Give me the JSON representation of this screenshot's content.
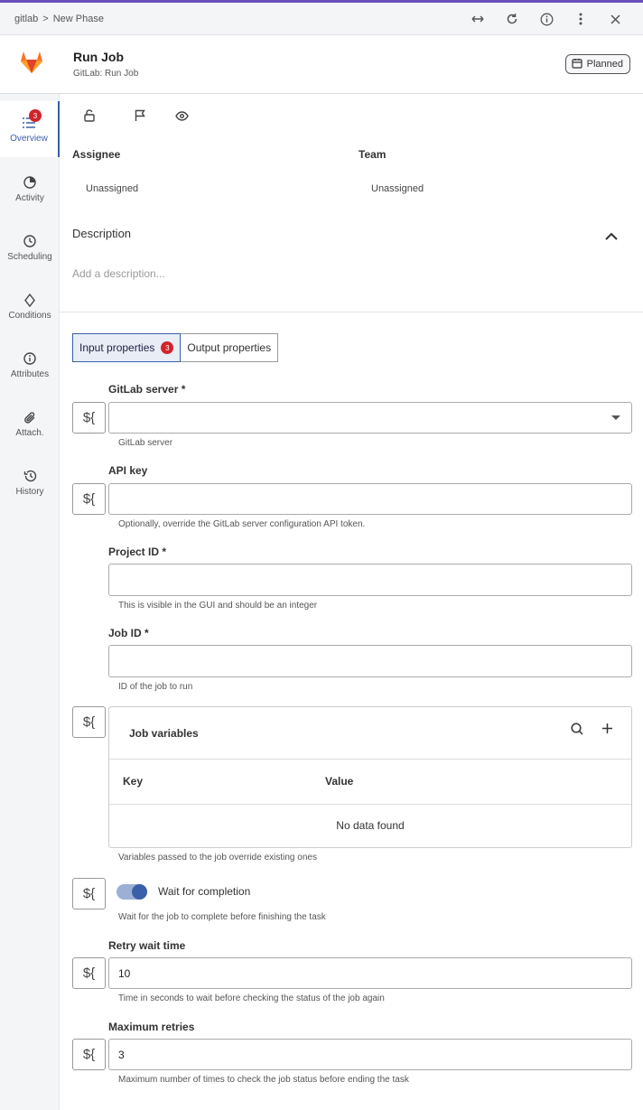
{
  "breadcrumb": {
    "root": "gitlab",
    "sep": ">",
    "current": "New Phase"
  },
  "window_icons": [
    "expand-horizontal-icon",
    "refresh-icon",
    "info-icon",
    "more-vertical-icon",
    "close-icon"
  ],
  "header": {
    "title": "Run Job",
    "subtitle": "GitLab: Run Job",
    "status": "Planned"
  },
  "sidebar": {
    "items": [
      {
        "label": "Overview",
        "icon": "list-icon",
        "badge": "3",
        "active": true
      },
      {
        "label": "Activity",
        "icon": "activity-icon"
      },
      {
        "label": "Scheduling",
        "icon": "clock-icon"
      },
      {
        "label": "Conditions",
        "icon": "diamond-icon"
      },
      {
        "label": "Attributes",
        "icon": "info-icon"
      },
      {
        "label": "Attach.",
        "icon": "paperclip-icon"
      },
      {
        "label": "History",
        "icon": "history-icon"
      }
    ]
  },
  "overview": {
    "assignee_label": "Assignee",
    "assignee_value": "Unassigned",
    "team_label": "Team",
    "team_value": "Unassigned",
    "description_label": "Description",
    "description_placeholder": "Add a description..."
  },
  "tabs": {
    "input_label": "Input properties",
    "input_count": "3",
    "output_label": "Output properties"
  },
  "expr_symbol": "${",
  "fields": {
    "server": {
      "label": "GitLab server *",
      "value": "",
      "help": "GitLab server"
    },
    "api_key": {
      "label": "API key",
      "value": "",
      "help": "Optionally, override the GitLab server configuration API token."
    },
    "project_id": {
      "label": "Project ID *",
      "value": "",
      "help": "This is visible in the GUI and should be an integer"
    },
    "job_id": {
      "label": "Job ID *",
      "value": "",
      "help": "ID of the job to run"
    },
    "job_variables": {
      "title": "Job variables",
      "col_key": "Key",
      "col_value": "Value",
      "empty": "No data found",
      "help": "Variables passed to the job override existing ones"
    },
    "wait": {
      "label": "Wait for completion",
      "enabled": true,
      "help": "Wait for the job to complete before finishing the task"
    },
    "retry_wait": {
      "label": "Retry wait time",
      "value": "10",
      "help": "Time in seconds to wait before checking the status of the job again"
    },
    "max_retries": {
      "label": "Maximum retries",
      "value": "3",
      "help": "Maximum number of times to check the job status before ending the task"
    }
  },
  "colors": {
    "accent": "#3b5fa8",
    "badge_red": "#d1232b",
    "sidebar_bg": "#f4f5f7"
  }
}
